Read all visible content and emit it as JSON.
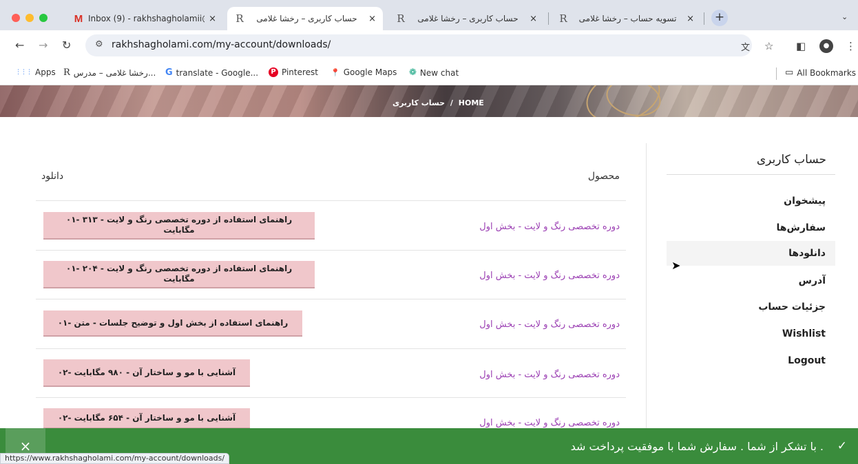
{
  "browser": {
    "tabs": [
      {
        "favicon": "M",
        "title": "Inbox (9) - rakhshagholamii@",
        "close": "×"
      },
      {
        "favicon": "R",
        "title": "حساب کاربری – رخشا غلامی",
        "close": "×"
      },
      {
        "favicon": "R",
        "title": "حساب کاربری – رخشا غلامی",
        "close": "×"
      },
      {
        "favicon": "R",
        "title": "تسویه حساب – رخشا غلامی",
        "close": "×"
      }
    ],
    "new_tab": "+",
    "tab_menu": "⌄",
    "url": "rakhshagholami.com/my-account/downloads/",
    "status_url": "https://www.rakhshagholami.com/my-account/downloads/"
  },
  "bookmarks": {
    "items": [
      {
        "icon": "apps-icon",
        "glyph": "⋮⋮⋮",
        "label": "Apps"
      },
      {
        "icon": "site-icon",
        "glyph": "R",
        "label": "رخشا غلامی – مدرس..."
      },
      {
        "icon": "google-translate-icon",
        "glyph": "G",
        "label": "translate - Google..."
      },
      {
        "icon": "pinterest-icon",
        "glyph": "P",
        "label": "Pinterest"
      },
      {
        "icon": "maps-pin-icon",
        "glyph": "📍",
        "label": "Google Maps"
      },
      {
        "icon": "chatgpt-icon",
        "glyph": "❁",
        "label": "New chat"
      }
    ],
    "all_bookmarks": "All Bookmarks"
  },
  "hero": {
    "home": "HOME",
    "sep": "/",
    "current": "حساب کاربری"
  },
  "account": {
    "title": "حساب کاربری",
    "menu": [
      {
        "label": "پیشخوان"
      },
      {
        "label": "سفارش‌ها"
      },
      {
        "label": "دانلودها"
      },
      {
        "label": "آدرس"
      },
      {
        "label": "جزئیات حساب"
      },
      {
        "label": "Wishlist"
      },
      {
        "label": "Logout"
      }
    ]
  },
  "downloads": {
    "col_product": "محصول",
    "col_download": "دانلود",
    "rows": [
      {
        "product": "دوره تخصصی رنگ و لایت - بخش اول",
        "file": "۰۱- راهنمای استفاده از دوره تخصصی رنگ و لایت - ۳۱۳ مگابایت"
      },
      {
        "product": "دوره تخصصی رنگ و لایت - بخش اول",
        "file": "۰۱- راهنمای استفاده از دوره تخصصی رنگ و لایت - ۲۰۴ مگابایت"
      },
      {
        "product": "دوره تخصصی رنگ و لایت - بخش اول",
        "file": "۰۱- راهنمای استفاده از بخش اول و توضیح جلسات - متن"
      },
      {
        "product": "دوره تخصصی رنگ و لایت - بخش اول",
        "file": "۰۲- آشنایی با مو و ساختار آن - ۹۸۰ مگابایت"
      },
      {
        "product": "دوره تخصصی رنگ و لایت - بخش اول",
        "file": "۰۲- آشنایی با مو و ساختار آن - ۶۵۴ مگابایت"
      }
    ]
  },
  "notice": {
    "text": "با تشکر از شما . سفارش شما با موفقیت پرداخت شد .",
    "close": "×",
    "check": "✓"
  },
  "colors": {
    "accent_purple": "#9b3fb3",
    "button_pink": "#f0c7cb",
    "notice_green": "#3a8c3c"
  }
}
